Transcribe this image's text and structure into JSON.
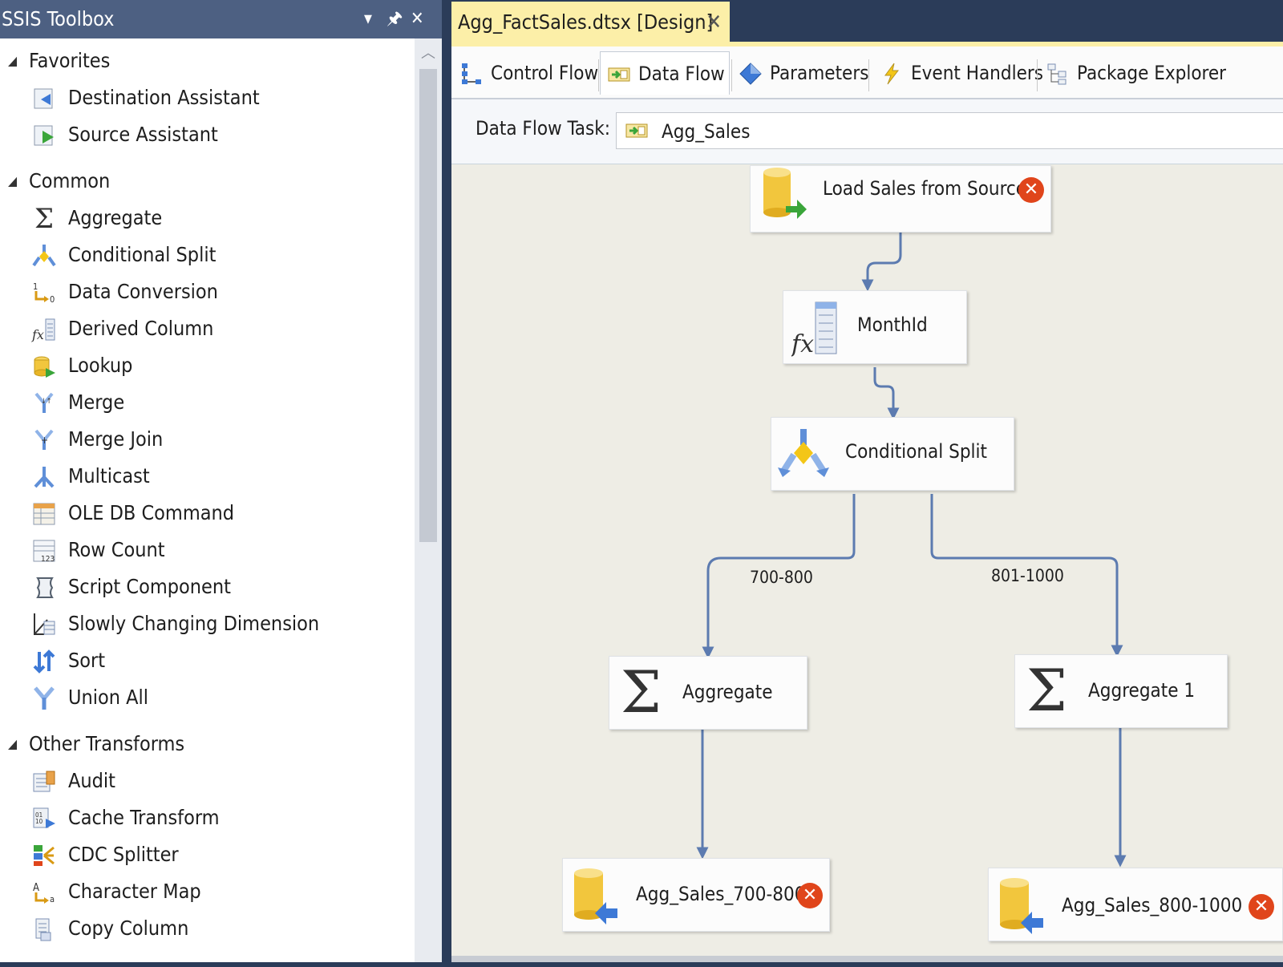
{
  "toolbox": {
    "title": "SSIS Toolbox",
    "sections": [
      {
        "label": "Favorites",
        "tools": [
          {
            "label": "Destination Assistant",
            "icon": "destination-assistant-icon"
          },
          {
            "label": "Source Assistant",
            "icon": "source-assistant-icon"
          }
        ]
      },
      {
        "label": "Common",
        "tools": [
          {
            "label": "Aggregate",
            "icon": "sigma-icon"
          },
          {
            "label": "Conditional Split",
            "icon": "conditional-split-icon"
          },
          {
            "label": "Data Conversion",
            "icon": "data-conversion-icon"
          },
          {
            "label": "Derived Column",
            "icon": "derived-column-icon"
          },
          {
            "label": "Lookup",
            "icon": "lookup-icon"
          },
          {
            "label": "Merge",
            "icon": "merge-icon"
          },
          {
            "label": "Merge Join",
            "icon": "merge-join-icon"
          },
          {
            "label": "Multicast",
            "icon": "multicast-icon"
          },
          {
            "label": "OLE DB Command",
            "icon": "ole-db-command-icon"
          },
          {
            "label": "Row Count",
            "icon": "row-count-icon"
          },
          {
            "label": "Script Component",
            "icon": "script-component-icon"
          },
          {
            "label": "Slowly Changing Dimension",
            "icon": "slowly-changing-dimension-icon"
          },
          {
            "label": "Sort",
            "icon": "sort-icon"
          },
          {
            "label": "Union All",
            "icon": "union-all-icon"
          }
        ]
      },
      {
        "label": "Other Transforms",
        "tools": [
          {
            "label": "Audit",
            "icon": "audit-icon"
          },
          {
            "label": "Cache Transform",
            "icon": "cache-transform-icon"
          },
          {
            "label": "CDC Splitter",
            "icon": "cdc-splitter-icon"
          },
          {
            "label": "Character Map",
            "icon": "character-map-icon"
          },
          {
            "label": "Copy Column",
            "icon": "copy-column-icon"
          }
        ]
      }
    ]
  },
  "document": {
    "tab_title": "Agg_FactSales.dtsx [Design]",
    "close_glyph": "✕"
  },
  "designer": {
    "tabs": [
      {
        "label": "Control Flow",
        "active": false
      },
      {
        "label": "Data Flow",
        "active": true
      },
      {
        "label": "Parameters",
        "active": false
      },
      {
        "label": "Event Handlers",
        "active": false
      },
      {
        "label": "Package Explorer",
        "active": false
      }
    ],
    "task_label": "Data Flow Task:",
    "task_value": "Agg_Sales"
  },
  "data_flow": {
    "components": {
      "source": {
        "label": "Load Sales from Source",
        "error": true
      },
      "derived": {
        "label": "MonthId",
        "error": false
      },
      "split": {
        "label": "Conditional Split",
        "error": false
      },
      "agg1": {
        "label": "Aggregate",
        "error": false
      },
      "agg2": {
        "label": "Aggregate 1",
        "error": false
      },
      "dest1": {
        "label": "Agg_Sales_700-800",
        "error": true
      },
      "dest2": {
        "label": "Agg_Sales_800-1000",
        "error": true
      }
    },
    "path_labels": {
      "left": "700-800",
      "right": "801-1000"
    }
  },
  "colors": {
    "title_bar": "#4d6082",
    "doc_tab": "#fcefa8",
    "canvas": "#eeede5",
    "connector": "#5c7bb0",
    "error": "#e0451b"
  }
}
